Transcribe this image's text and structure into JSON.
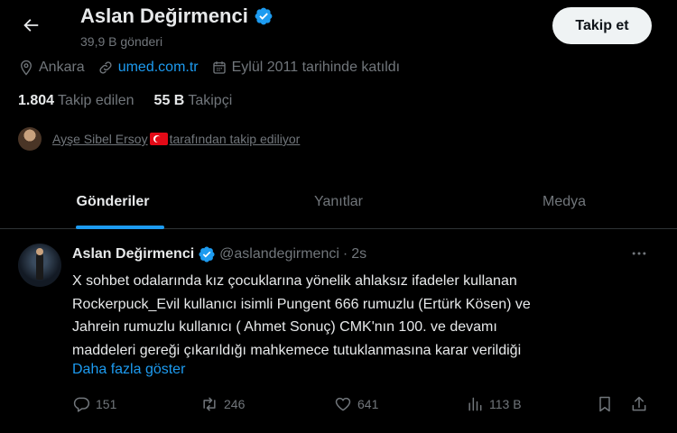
{
  "header": {
    "name": "Aslan Değirmenci",
    "post_count": "39,9 B gönderi",
    "follow_label": "Takip et"
  },
  "profile": {
    "location": "Ankara",
    "website": "umed.com.tr",
    "joined": "Eylül 2011 tarihinde katıldı",
    "following_count": "1.804",
    "following_label": "Takip edilen",
    "followers_count": "55 B",
    "followers_label": "Takipçi",
    "followed_by_name": "Ayşe Sibel Ersoy",
    "followed_by_suffix": "tarafından takip ediliyor"
  },
  "tabs": [
    {
      "label": "Gönderiler",
      "active": true
    },
    {
      "label": "Yanıtlar",
      "active": false
    },
    {
      "label": "Medya",
      "active": false
    }
  ],
  "tweet": {
    "name": "Aslan Değirmenci",
    "handle": "@aslandegirmenci",
    "dot": "·",
    "time": "2s",
    "lines": [
      "X sohbet odalarında kız çocuklarına yönelik ahlaksız ifadeler kullanan",
      "Rockerpuck_Evil kullanıcı isimli Pungent 666 rumuzlu (Ertürk Kösen) ve",
      "Jahrein rumuzlu kullanıcı ( Ahmet Sonuç) CMK'nın 100. ve devamı",
      "maddeleri gereği çıkarıldığı mahkemece tutuklanmasına karar verildiği"
    ],
    "show_more": "Daha fazla göster",
    "actions": {
      "replies": "151",
      "reposts": "246",
      "likes": "641",
      "views": "113 B"
    }
  },
  "colors": {
    "background": "#000000",
    "accent": "#1d9bf0",
    "muted": "#71767b",
    "text": "#e7e9ea"
  }
}
